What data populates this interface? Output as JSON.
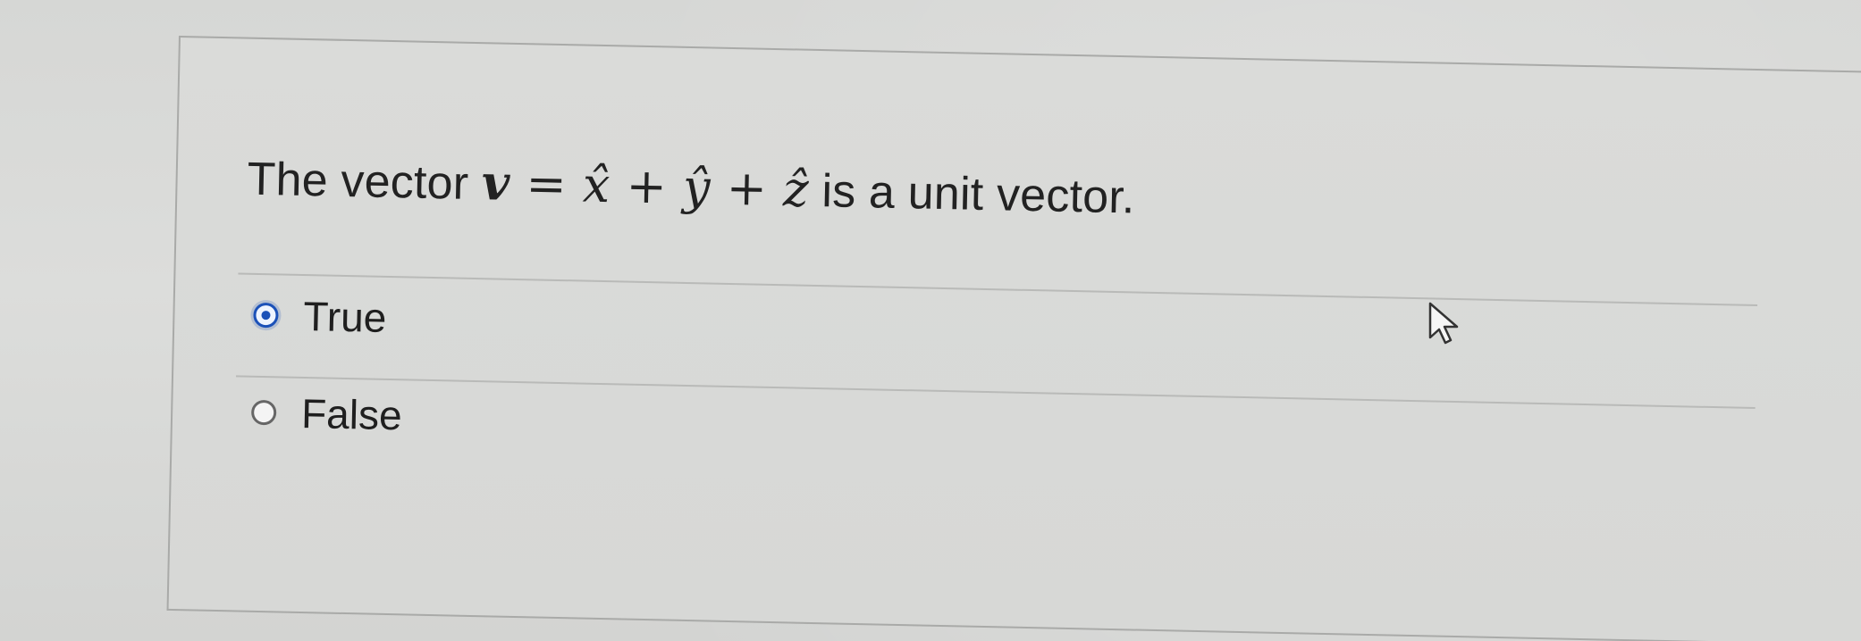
{
  "question": {
    "prefix": "The vector ",
    "math": {
      "v": "v",
      "eq": "=",
      "x": "x̂",
      "plus1": "+",
      "y": "ŷ",
      "plus2": "+",
      "z": "ẑ"
    },
    "suffix": " is a unit vector."
  },
  "options": [
    {
      "label": "True",
      "selected": true
    },
    {
      "label": "False",
      "selected": false
    }
  ],
  "colors": {
    "selected_radio": "#1b51b8",
    "text": "#222222",
    "background": "#d9dad8"
  },
  "icons": {
    "cursor": "mouse-pointer-icon"
  }
}
